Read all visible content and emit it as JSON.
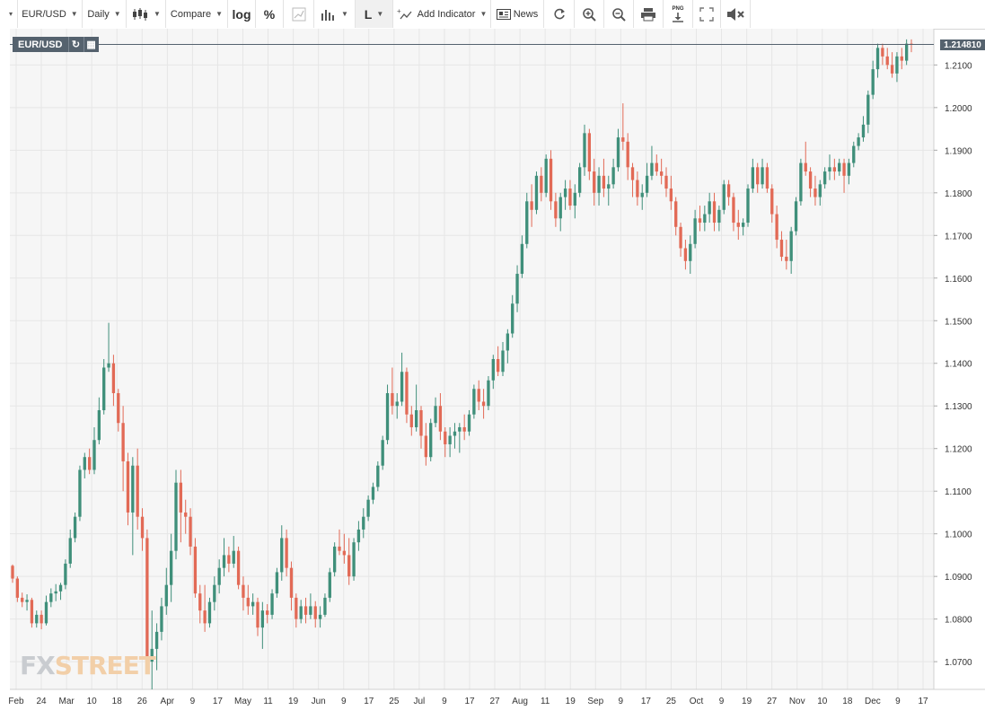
{
  "toolbar": {
    "edge_caret": "▾",
    "symbol": "EUR/USD",
    "interval": "Daily",
    "compare": "Compare",
    "log": "log",
    "percent": "%",
    "line_tool": "L",
    "add_indicator": "Add Indicator",
    "news": "News",
    "png": "PNG"
  },
  "colors": {
    "up": "#3f8f7a",
    "down": "#e26a56",
    "price_line": "#55626e",
    "grid": "#e6e6e6"
  },
  "icons": [
    "chart-type-icon",
    "bar-chart-icon",
    "refresh-icon",
    "zoom-in-icon",
    "zoom-out-icon",
    "print-icon",
    "download-png-icon",
    "fullscreen-icon",
    "mute-icon"
  ],
  "badge": {
    "symbol": "EUR/USD"
  },
  "last_price_label": "1.214810",
  "watermark": {
    "fx": "FX",
    "street": "STREET"
  },
  "chart_data": {
    "type": "candlestick",
    "series_name": "EUR/USD",
    "interval": "Daily",
    "last_price": 1.21481,
    "ylim": [
      1.0635,
      1.2185
    ],
    "y_ticks": [
      "1.2100",
      "1.2000",
      "1.1900",
      "1.1800",
      "1.1700",
      "1.1600",
      "1.1500",
      "1.1400",
      "1.1300",
      "1.1200",
      "1.1100",
      "1.1000",
      "1.0900",
      "1.0800",
      "1.0700"
    ],
    "x_ticks": [
      "Feb",
      "24",
      "Mar",
      "10",
      "18",
      "26",
      "Apr",
      "9",
      "17",
      "May",
      "11",
      "19",
      "Jun",
      "9",
      "17",
      "25",
      "Jul",
      "9",
      "17",
      "27",
      "Aug",
      "11",
      "19",
      "Sep",
      "9",
      "17",
      "25",
      "Oct",
      "9",
      "19",
      "27",
      "Nov",
      "10",
      "18",
      "Dec",
      "9",
      "17"
    ],
    "grid": true,
    "candles": [
      [
        1.0925,
        1.0928,
        1.0885,
        1.0895
      ],
      [
        1.0895,
        1.09,
        1.084,
        1.085
      ],
      [
        1.085,
        1.0862,
        1.0828,
        1.084
      ],
      [
        1.084,
        1.0858,
        1.082,
        1.0845
      ],
      [
        1.0845,
        1.085,
        1.078,
        1.079
      ],
      [
        1.079,
        1.082,
        1.078,
        1.081
      ],
      [
        1.081,
        1.082,
        1.0776,
        1.079
      ],
      [
        1.079,
        1.0855,
        1.0785,
        1.084
      ],
      [
        1.084,
        1.0872,
        1.0828,
        1.086
      ],
      [
        1.086,
        1.0882,
        1.0842,
        1.0865
      ],
      [
        1.0865,
        1.0885,
        1.0845,
        1.088
      ],
      [
        1.088,
        1.094,
        1.087,
        1.093
      ],
      [
        1.093,
        1.101,
        1.092,
        1.099
      ],
      [
        1.099,
        1.105,
        1.098,
        1.104
      ],
      [
        1.104,
        1.116,
        1.103,
        1.115
      ],
      [
        1.115,
        1.119,
        1.113,
        1.118
      ],
      [
        1.118,
        1.12,
        1.114,
        1.115
      ],
      [
        1.115,
        1.125,
        1.114,
        1.122
      ],
      [
        1.122,
        1.132,
        1.121,
        1.129
      ],
      [
        1.129,
        1.141,
        1.128,
        1.139
      ],
      [
        1.139,
        1.1495,
        1.138,
        1.14
      ],
      [
        1.14,
        1.142,
        1.13,
        1.133
      ],
      [
        1.133,
        1.134,
        1.124,
        1.126
      ],
      [
        1.126,
        1.13,
        1.11,
        1.117
      ],
      [
        1.117,
        1.119,
        1.102,
        1.105
      ],
      [
        1.105,
        1.118,
        1.095,
        1.116
      ],
      [
        1.116,
        1.12,
        1.101,
        1.104
      ],
      [
        1.104,
        1.106,
        1.096,
        1.099
      ],
      [
        1.099,
        1.101,
        1.068,
        1.07
      ],
      [
        1.07,
        1.082,
        1.0635,
        1.073
      ],
      [
        1.073,
        1.079,
        1.068,
        1.077
      ],
      [
        1.077,
        1.085,
        1.075,
        1.083
      ],
      [
        1.083,
        1.092,
        1.081,
        1.088
      ],
      [
        1.088,
        1.1,
        1.084,
        1.096
      ],
      [
        1.096,
        1.115,
        1.094,
        1.112
      ],
      [
        1.112,
        1.115,
        1.098,
        1.105
      ],
      [
        1.105,
        1.108,
        1.1,
        1.104
      ],
      [
        1.104,
        1.106,
        1.095,
        1.097
      ],
      [
        1.097,
        1.099,
        1.085,
        1.086
      ],
      [
        1.086,
        1.088,
        1.079,
        1.082
      ],
      [
        1.082,
        1.088,
        1.077,
        1.079
      ],
      [
        1.079,
        1.085,
        1.078,
        1.084
      ],
      [
        1.084,
        1.09,
        1.082,
        1.088
      ],
      [
        1.088,
        1.094,
        1.086,
        1.092
      ],
      [
        1.092,
        1.099,
        1.09,
        1.095
      ],
      [
        1.095,
        1.097,
        1.091,
        1.093
      ],
      [
        1.093,
        1.0995,
        1.092,
        1.096
      ],
      [
        1.096,
        1.097,
        1.087,
        1.088
      ],
      [
        1.088,
        1.09,
        1.082,
        1.085
      ],
      [
        1.085,
        1.088,
        1.081,
        1.083
      ],
      [
        1.083,
        1.086,
        1.081,
        1.084
      ],
      [
        1.084,
        1.085,
        1.076,
        1.078
      ],
      [
        1.078,
        1.084,
        1.073,
        1.082
      ],
      [
        1.082,
        1.0835,
        1.079,
        1.081
      ],
      [
        1.081,
        1.087,
        1.08,
        1.086
      ],
      [
        1.086,
        1.092,
        1.085,
        1.091
      ],
      [
        1.091,
        1.102,
        1.089,
        1.099
      ],
      [
        1.099,
        1.101,
        1.09,
        1.092
      ],
      [
        1.092,
        1.0935,
        1.082,
        1.085
      ],
      [
        1.085,
        1.086,
        1.078,
        1.08
      ],
      [
        1.08,
        1.0845,
        1.079,
        1.083
      ],
      [
        1.083,
        1.085,
        1.079,
        1.081
      ],
      [
        1.081,
        1.086,
        1.08,
        1.083
      ],
      [
        1.083,
        1.0842,
        1.078,
        1.08
      ],
      [
        1.08,
        1.083,
        1.078,
        1.081
      ],
      [
        1.081,
        1.086,
        1.0805,
        1.085
      ],
      [
        1.085,
        1.092,
        1.084,
        1.091
      ],
      [
        1.091,
        1.098,
        1.09,
        1.097
      ],
      [
        1.097,
        1.101,
        1.095,
        1.096
      ],
      [
        1.096,
        1.1,
        1.093,
        1.095
      ],
      [
        1.095,
        1.099,
        1.088,
        1.09
      ],
      [
        1.09,
        1.099,
        1.089,
        1.098
      ],
      [
        1.098,
        1.103,
        1.096,
        1.101
      ],
      [
        1.101,
        1.106,
        1.099,
        1.104
      ],
      [
        1.104,
        1.109,
        1.103,
        1.108
      ],
      [
        1.108,
        1.112,
        1.107,
        1.111
      ],
      [
        1.111,
        1.117,
        1.11,
        1.116
      ],
      [
        1.116,
        1.123,
        1.115,
        1.122
      ],
      [
        1.122,
        1.135,
        1.121,
        1.133
      ],
      [
        1.133,
        1.139,
        1.128,
        1.13
      ],
      [
        1.13,
        1.133,
        1.127,
        1.131
      ],
      [
        1.131,
        1.1425,
        1.13,
        1.138
      ],
      [
        1.138,
        1.139,
        1.126,
        1.128
      ],
      [
        1.128,
        1.13,
        1.123,
        1.125
      ],
      [
        1.125,
        1.135,
        1.124,
        1.129
      ],
      [
        1.129,
        1.13,
        1.12,
        1.123
      ],
      [
        1.123,
        1.126,
        1.116,
        1.118
      ],
      [
        1.118,
        1.127,
        1.117,
        1.126
      ],
      [
        1.126,
        1.132,
        1.125,
        1.13
      ],
      [
        1.13,
        1.133,
        1.122,
        1.124
      ],
      [
        1.124,
        1.125,
        1.118,
        1.121
      ],
      [
        1.121,
        1.125,
        1.118,
        1.123
      ],
      [
        1.123,
        1.126,
        1.12,
        1.124
      ],
      [
        1.124,
        1.126,
        1.119,
        1.125
      ],
      [
        1.125,
        1.128,
        1.122,
        1.124
      ],
      [
        1.124,
        1.129,
        1.123,
        1.128
      ],
      [
        1.128,
        1.135,
        1.127,
        1.134
      ],
      [
        1.134,
        1.136,
        1.129,
        1.131
      ],
      [
        1.131,
        1.134,
        1.127,
        1.13
      ],
      [
        1.13,
        1.137,
        1.129,
        1.136
      ],
      [
        1.136,
        1.142,
        1.134,
        1.141
      ],
      [
        1.141,
        1.144,
        1.137,
        1.138
      ],
      [
        1.138,
        1.145,
        1.137,
        1.143
      ],
      [
        1.143,
        1.148,
        1.14,
        1.147
      ],
      [
        1.147,
        1.156,
        1.146,
        1.154
      ],
      [
        1.154,
        1.163,
        1.152,
        1.161
      ],
      [
        1.161,
        1.17,
        1.16,
        1.168
      ],
      [
        1.168,
        1.18,
        1.167,
        1.178
      ],
      [
        1.178,
        1.182,
        1.172,
        1.176
      ],
      [
        1.176,
        1.185,
        1.175,
        1.184
      ],
      [
        1.184,
        1.186,
        1.178,
        1.18
      ],
      [
        1.18,
        1.189,
        1.179,
        1.188
      ],
      [
        1.188,
        1.19,
        1.176,
        1.178
      ],
      [
        1.178,
        1.18,
        1.172,
        1.174
      ],
      [
        1.174,
        1.18,
        1.171,
        1.179
      ],
      [
        1.179,
        1.183,
        1.176,
        1.181
      ],
      [
        1.181,
        1.183,
        1.176,
        1.177
      ],
      [
        1.177,
        1.182,
        1.174,
        1.18
      ],
      [
        1.18,
        1.187,
        1.179,
        1.186
      ],
      [
        1.186,
        1.196,
        1.184,
        1.194
      ],
      [
        1.194,
        1.195,
        1.183,
        1.185
      ],
      [
        1.185,
        1.188,
        1.177,
        1.18
      ],
      [
        1.18,
        1.186,
        1.177,
        1.184
      ],
      [
        1.184,
        1.188,
        1.179,
        1.181
      ],
      [
        1.181,
        1.184,
        1.177,
        1.182
      ],
      [
        1.182,
        1.188,
        1.181,
        1.186
      ],
      [
        1.186,
        1.195,
        1.185,
        1.193
      ],
      [
        1.193,
        1.201,
        1.19,
        1.192
      ],
      [
        1.192,
        1.194,
        1.183,
        1.186
      ],
      [
        1.186,
        1.187,
        1.179,
        1.183
      ],
      [
        1.183,
        1.185,
        1.177,
        1.179
      ],
      [
        1.179,
        1.182,
        1.176,
        1.18
      ],
      [
        1.18,
        1.187,
        1.179,
        1.184
      ],
      [
        1.184,
        1.191,
        1.183,
        1.187
      ],
      [
        1.187,
        1.189,
        1.184,
        1.185
      ],
      [
        1.185,
        1.188,
        1.182,
        1.184
      ],
      [
        1.184,
        1.186,
        1.179,
        1.181
      ],
      [
        1.181,
        1.184,
        1.176,
        1.178
      ],
      [
        1.178,
        1.179,
        1.17,
        1.172
      ],
      [
        1.172,
        1.173,
        1.165,
        1.167
      ],
      [
        1.167,
        1.169,
        1.162,
        1.164
      ],
      [
        1.164,
        1.17,
        1.161,
        1.168
      ],
      [
        1.168,
        1.176,
        1.167,
        1.174
      ],
      [
        1.174,
        1.177,
        1.171,
        1.173
      ],
      [
        1.173,
        1.177,
        1.171,
        1.175
      ],
      [
        1.175,
        1.18,
        1.173,
        1.178
      ],
      [
        1.178,
        1.18,
        1.171,
        1.173
      ],
      [
        1.173,
        1.177,
        1.171,
        1.176
      ],
      [
        1.176,
        1.183,
        1.175,
        1.182
      ],
      [
        1.182,
        1.183,
        1.177,
        1.179
      ],
      [
        1.179,
        1.18,
        1.171,
        1.173
      ],
      [
        1.173,
        1.176,
        1.169,
        1.172
      ],
      [
        1.172,
        1.174,
        1.17,
        1.173
      ],
      [
        1.173,
        1.182,
        1.172,
        1.181
      ],
      [
        1.181,
        1.188,
        1.18,
        1.186
      ],
      [
        1.186,
        1.187,
        1.18,
        1.182
      ],
      [
        1.182,
        1.188,
        1.181,
        1.186
      ],
      [
        1.186,
        1.187,
        1.18,
        1.181
      ],
      [
        1.181,
        1.182,
        1.173,
        1.175
      ],
      [
        1.175,
        1.177,
        1.167,
        1.169
      ],
      [
        1.169,
        1.171,
        1.164,
        1.165
      ],
      [
        1.165,
        1.169,
        1.162,
        1.164
      ],
      [
        1.164,
        1.172,
        1.161,
        1.171
      ],
      [
        1.171,
        1.179,
        1.17,
        1.178
      ],
      [
        1.178,
        1.188,
        1.177,
        1.187
      ],
      [
        1.187,
        1.192,
        1.184,
        1.185
      ],
      [
        1.185,
        1.186,
        1.179,
        1.181
      ],
      [
        1.181,
        1.184,
        1.177,
        1.179
      ],
      [
        1.179,
        1.183,
        1.177,
        1.182
      ],
      [
        1.182,
        1.186,
        1.181,
        1.185
      ],
      [
        1.185,
        1.189,
        1.183,
        1.186
      ],
      [
        1.186,
        1.188,
        1.183,
        1.185
      ],
      [
        1.185,
        1.188,
        1.184,
        1.187
      ],
      [
        1.187,
        1.188,
        1.18,
        1.184
      ],
      [
        1.184,
        1.188,
        1.182,
        1.187
      ],
      [
        1.187,
        1.192,
        1.186,
        1.191
      ],
      [
        1.191,
        1.194,
        1.19,
        1.193
      ],
      [
        1.193,
        1.198,
        1.192,
        1.196
      ],
      [
        1.196,
        1.204,
        1.194,
        1.203
      ],
      [
        1.203,
        1.211,
        1.202,
        1.209
      ],
      [
        1.209,
        1.215,
        1.207,
        1.214
      ],
      [
        1.214,
        1.215,
        1.21,
        1.212
      ],
      [
        1.212,
        1.214,
        1.209,
        1.21
      ],
      [
        1.21,
        1.213,
        1.207,
        1.208
      ],
      [
        1.208,
        1.213,
        1.206,
        1.212
      ],
      [
        1.212,
        1.214,
        1.209,
        1.211
      ],
      [
        1.211,
        1.216,
        1.21,
        1.215
      ],
      [
        1.215,
        1.216,
        1.213,
        1.2148
      ]
    ]
  }
}
